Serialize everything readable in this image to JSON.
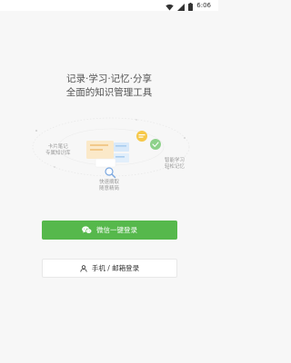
{
  "status_bar": {
    "time": "6:06",
    "icons": [
      "wifi-icon",
      "signal-icon",
      "battery-icon"
    ]
  },
  "hero": {
    "title": "记录·学习·记忆·分享",
    "subtitle": "全面的知识管理工具"
  },
  "illustration": {
    "features": [
      {
        "line1": "卡片笔记",
        "line2": "专属知识库"
      },
      {
        "line1": "智能学习",
        "line2": "轻松记忆"
      },
      {
        "line1": "快速摘取",
        "line2": "随意精简"
      }
    ]
  },
  "login": {
    "wechat_label": "微信一键登录",
    "phone_label": "手机 / 邮箱登录"
  },
  "colors": {
    "wechat_green": "#56b84c",
    "background": "#f7f7f7"
  }
}
